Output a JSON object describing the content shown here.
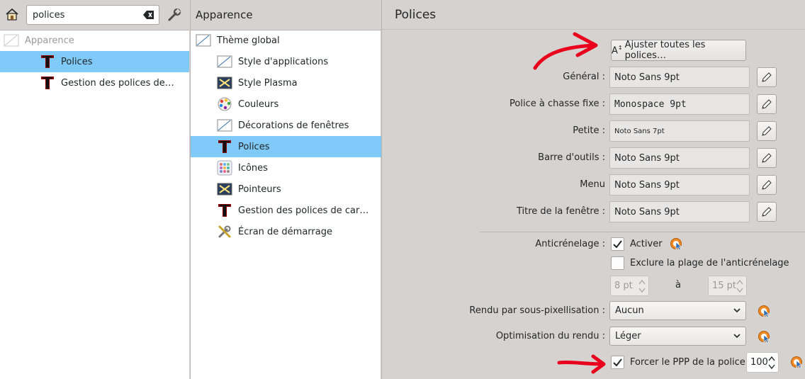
{
  "search": {
    "value": "polices"
  },
  "left_tree": [
    {
      "label": "Apparence",
      "selected": false,
      "muted": true
    },
    {
      "label": "Polices",
      "selected": true
    },
    {
      "label": "Gestion des polices de…",
      "selected": false
    }
  ],
  "middle": {
    "title": "Apparence",
    "items": [
      {
        "label": "Thème global",
        "icon": "theme-icon",
        "selected": false
      },
      {
        "label": "Style d'applications",
        "icon": "style-icon",
        "selected": false
      },
      {
        "label": "Style Plasma",
        "icon": "plasma-icon",
        "selected": false
      },
      {
        "label": "Couleurs",
        "icon": "palette-icon",
        "selected": false
      },
      {
        "label": "Décorations de fenêtres",
        "icon": "window-deco-icon",
        "selected": false
      },
      {
        "label": "Polices",
        "icon": "font-icon",
        "selected": true
      },
      {
        "label": "Icônes",
        "icon": "icons-icon",
        "selected": false
      },
      {
        "label": "Pointeurs",
        "icon": "cursor-icon",
        "selected": false
      },
      {
        "label": "Gestion des polices de car…",
        "icon": "font-icon",
        "selected": false
      },
      {
        "label": "Écran de démarrage",
        "icon": "splash-icon",
        "selected": false
      }
    ]
  },
  "right": {
    "title": "Polices",
    "adjust_all_label": "Ajuster toutes les polices…",
    "adjust_all_prefix": "A",
    "fonts": [
      {
        "label": "Général :",
        "value": "Noto Sans 9pt"
      },
      {
        "label": "Police à chasse fixe :",
        "value": "Monospace 9pt"
      },
      {
        "label": "Petite :",
        "value": "Noto Sans 7pt"
      },
      {
        "label": "Barre d'outils :",
        "value": "Noto Sans 9pt"
      },
      {
        "label": "Menu",
        "value": "Noto Sans 9pt"
      },
      {
        "label": "Titre de la fenêtre :",
        "value": "Noto Sans 9pt"
      }
    ],
    "antialias_label": "Anticrénelage :",
    "antialias_enable": "Activer",
    "exclude_label": "Exclure la plage de l'anticrénelage",
    "exclude_from": "8 pt",
    "exclude_to_word": "à",
    "exclude_to": "15 pt",
    "subpixel_label": "Rendu par sous-pixellisation :",
    "subpixel_value": "Aucun",
    "hinting_label": "Optimisation du rendu :",
    "hinting_value": "Léger",
    "dpi_label": "Forcer le PPP de la police :",
    "dpi_value": "100"
  },
  "colors": {
    "selection": "#7fcaf9",
    "annotation": "#e8001c"
  }
}
